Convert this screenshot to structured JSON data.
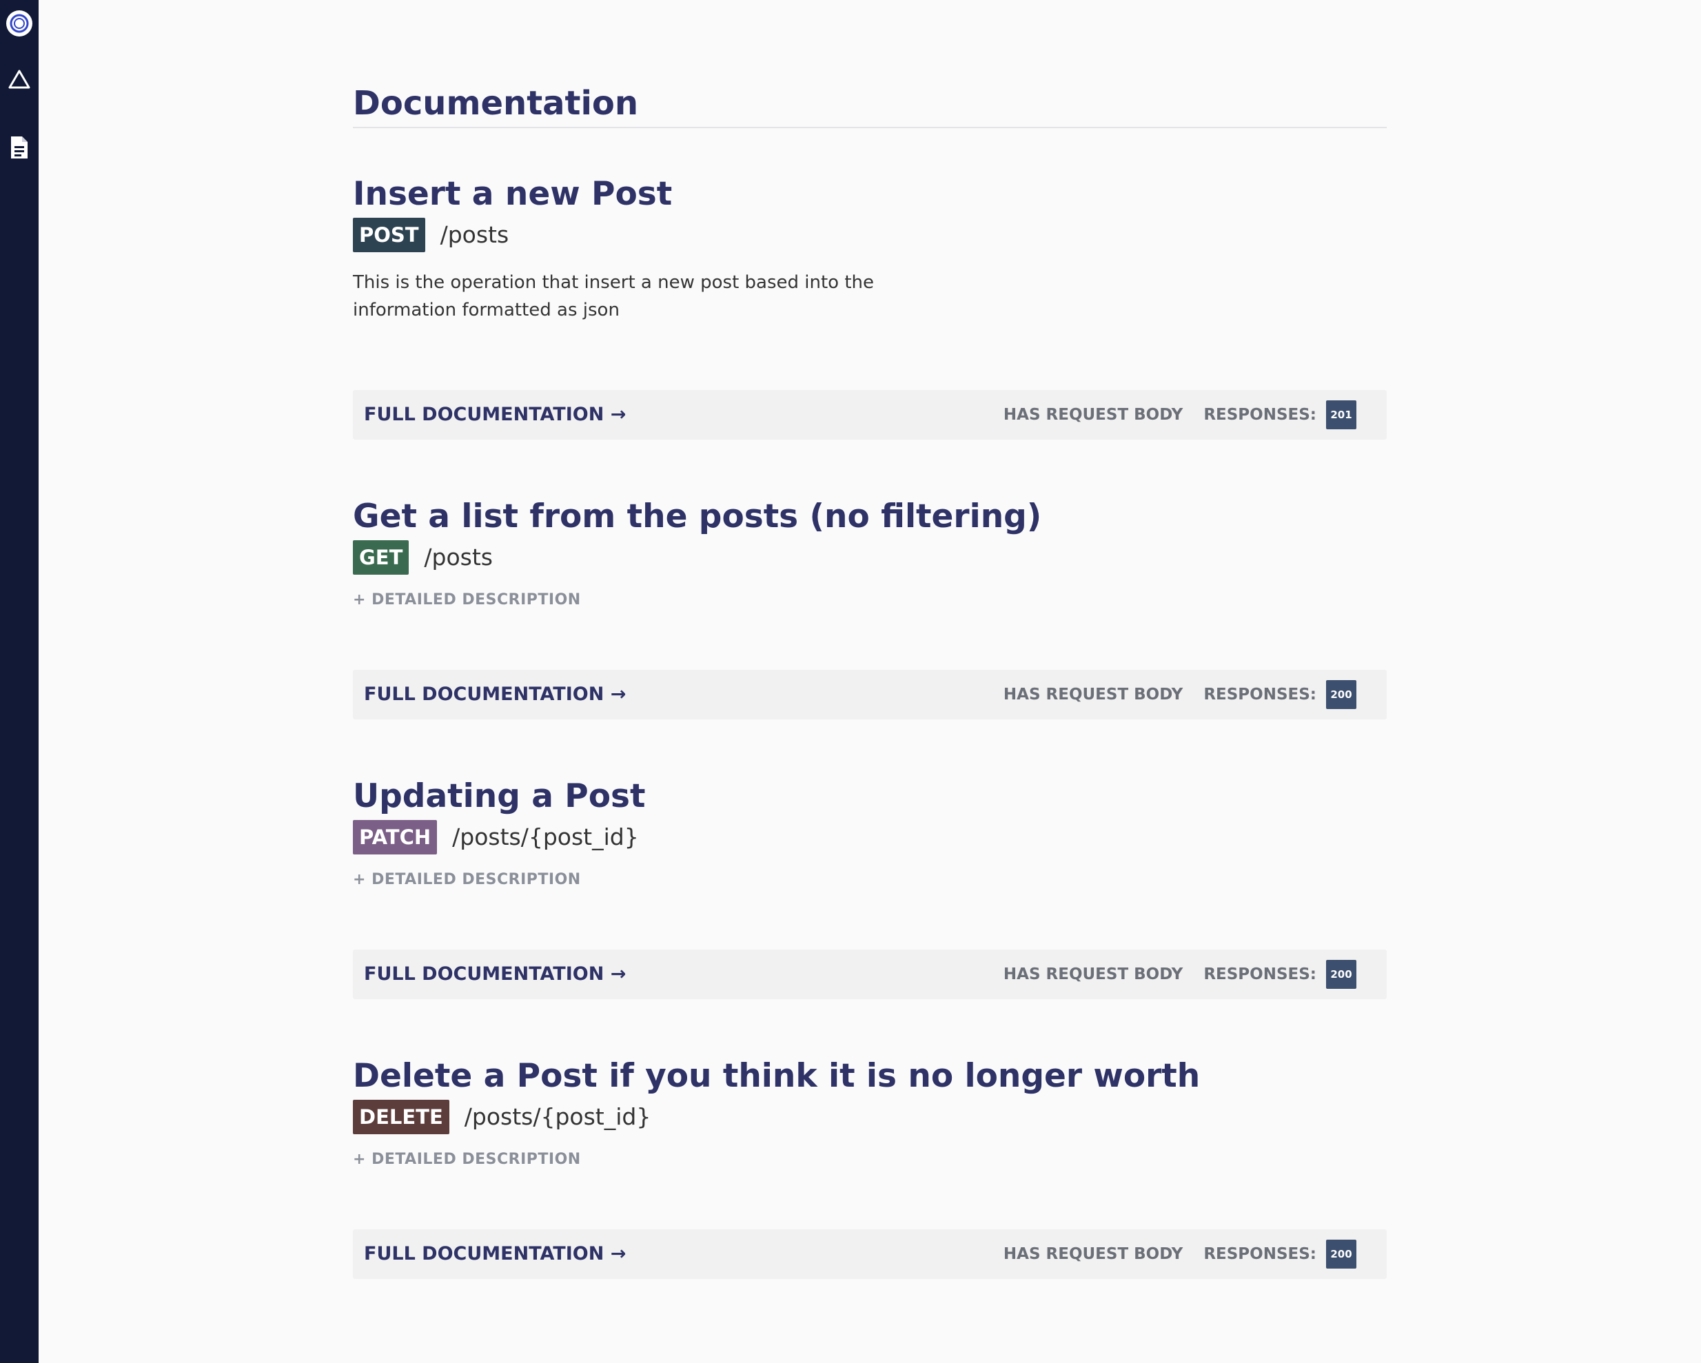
{
  "sidebar": {
    "icons": [
      "logo-icon",
      "triangle-icon",
      "document-icon"
    ]
  },
  "page": {
    "title": "Documentation"
  },
  "operations": [
    {
      "title": "Insert a new Post",
      "method": "POST",
      "method_color": "#2d4351",
      "path": "/posts",
      "description": "This is the operation that insert a new post based into the information formatted as json",
      "full_doc": "FULL DOCUMENTATION →",
      "has_request_body": "HAS REQUEST BODY",
      "responses_label": "RESPONSES:",
      "response_code": "201"
    },
    {
      "title": "Get a list from the posts (no filtering)",
      "method": "GET",
      "method_color": "#3a6a4f",
      "path": "/posts",
      "detail_link": "+ DETAILED DESCRIPTION",
      "full_doc": "FULL DOCUMENTATION →",
      "has_request_body": "HAS REQUEST BODY",
      "responses_label": "RESPONSES:",
      "response_code": "200"
    },
    {
      "title": "Updating a Post",
      "method": "PATCH",
      "method_color": "#7b5f87",
      "path": "/posts/{post_id}",
      "detail_link": "+ DETAILED DESCRIPTION",
      "full_doc": "FULL DOCUMENTATION →",
      "has_request_body": "HAS REQUEST BODY",
      "responses_label": "RESPONSES:",
      "response_code": "200"
    },
    {
      "title": "Delete a Post if you think it is no longer worth",
      "method": "DELETE",
      "method_color": "#5d3d3b",
      "path": "/posts/{post_id}",
      "detail_link": "+ DETAILED DESCRIPTION",
      "full_doc": "FULL DOCUMENTATION →",
      "has_request_body": "HAS REQUEST BODY",
      "responses_label": "RESPONSES:",
      "response_code": "200"
    }
  ]
}
